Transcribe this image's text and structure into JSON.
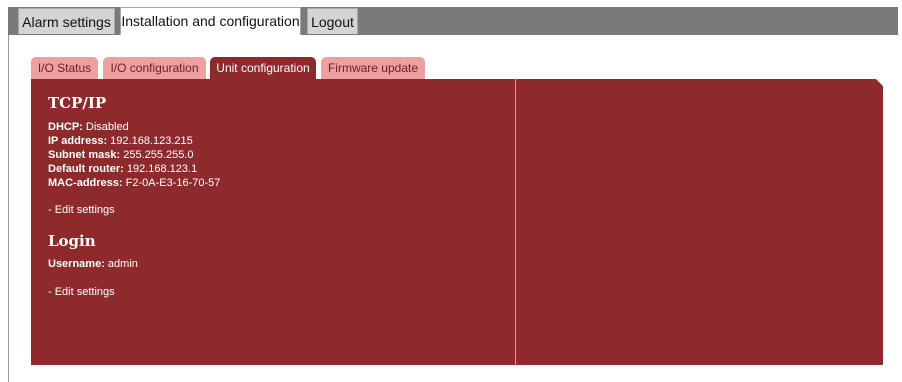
{
  "top_tabs": [
    {
      "label": "Alarm settings"
    },
    {
      "label": "Installation and configuration"
    },
    {
      "label": "Logout"
    }
  ],
  "sub_tabs": [
    {
      "label": "I/O Status"
    },
    {
      "label": "I/O configuration"
    },
    {
      "label": "Unit configuration"
    },
    {
      "label": "Firmware update"
    }
  ],
  "tcpip": {
    "title": "TCP/IP",
    "fields": [
      {
        "label": "DHCP:",
        "value": "Disabled"
      },
      {
        "label": "IP address:",
        "value": "192.168.123.215"
      },
      {
        "label": "Subnet mask:",
        "value": "255.255.255.0"
      },
      {
        "label": "Default router:",
        "value": "192.168.123.1"
      },
      {
        "label": "MAC-address:",
        "value": "F2-0A-E3-16-70-57"
      }
    ],
    "edit_link": "- Edit settings"
  },
  "login": {
    "title": "Login",
    "fields": [
      {
        "label": "Username:",
        "value": "admin"
      }
    ],
    "edit_link": "- Edit settings"
  },
  "colors": {
    "panel": "#8e2a2c",
    "inactive_subtab": "#ee9f9f",
    "topbar": "#7a7a7a"
  }
}
